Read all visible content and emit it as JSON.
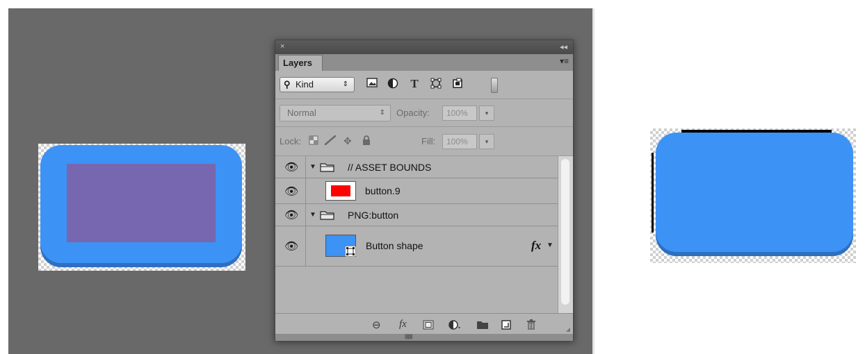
{
  "panel": {
    "close_glyph": "×",
    "collapse_glyph": "◂◂",
    "tab_label": "Layers",
    "menu_glyph": "▾≡",
    "filter": {
      "search_glyph": "⚲",
      "kind_label": "Kind",
      "select_arrows": "⇕",
      "icons": [
        "image-filter-icon",
        "adjustment-filter-icon",
        "type-filter-icon",
        "shape-filter-icon",
        "smart-object-filter-icon"
      ]
    },
    "blend_mode": "Normal",
    "opacity_label": "Opacity:",
    "opacity_value": "100%",
    "lock_label": "Lock:",
    "fill_label": "Fill:",
    "fill_value": "100%",
    "layers": [
      {
        "name": "// ASSET BOUNDS",
        "type": "group",
        "expanded": true,
        "visible": true
      },
      {
        "name": "button.9",
        "type": "layer",
        "thumb_color": "#ff0000",
        "visible": true
      },
      {
        "name": "PNG:button",
        "type": "group",
        "expanded": true,
        "visible": true
      },
      {
        "name": "Button shape",
        "type": "shape",
        "thumb_color": "#3d92f5",
        "fx": "fx",
        "visible": true
      }
    ],
    "bottom_icons": [
      "link-layers-icon",
      "fx-icon",
      "mask-icon",
      "adjustment-icon",
      "new-group-icon",
      "new-layer-icon",
      "trash-icon"
    ]
  },
  "colors": {
    "workspace": "#696969",
    "button_blue": "#3d92f5",
    "purple_overlay": "#7767b0",
    "asset_bounds_red": "#ff0000"
  }
}
